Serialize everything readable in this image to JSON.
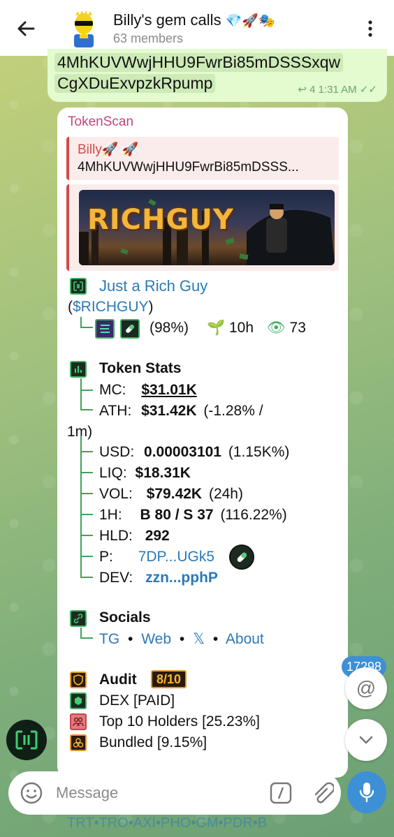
{
  "header": {
    "title": "Billy's gem calls",
    "title_emoji": "💎🚀🎭",
    "members": "63 members"
  },
  "sent_message": {
    "line1": "4MhKUVWwjHHU9FwrBi85mDSSSxqw",
    "line2": "CgXDuExvpzkRpump",
    "replies": "4",
    "time": "1:31 AM"
  },
  "card": {
    "sender": "TokenScan",
    "reply_name": "Billy🚀 🚀",
    "reply_text": "4MhKUVWwjHHU9FwrBi85mDSSS...",
    "banner_text": "RICHGUY",
    "token_name": "Just a Rich Guy",
    "ticker_open": "(",
    "ticker": "$RICHGUY",
    "ticker_close": ")",
    "pct": "(98%)",
    "age": "10h",
    "views": "73",
    "stats_title": "Token Stats",
    "mc_label": "MC:",
    "mc_value": "$31.01K",
    "ath_label": "ATH:",
    "ath_value": "$31.42K",
    "ath_change": "(-1.28% /",
    "ath_period": "1m)",
    "usd_label": "USD:",
    "usd_value": "0.00003101",
    "usd_change": "(1.15K%)",
    "liq_label": "LIQ:",
    "liq_value": "$18.31K",
    "vol_label": "VOL:",
    "vol_value": "$79.42K",
    "vol_period": "(24h)",
    "h1_label": "1H:",
    "h1_value": "B 80 / S 37",
    "h1_change": "(116.22%)",
    "hld_label": "HLD:",
    "hld_value": "292",
    "p_label": "P:",
    "p_value": "7DP...UGk5",
    "dev_label": "DEV:",
    "dev_value": "zzn...pphP",
    "socials_title": "Socials",
    "social_tg": "TG",
    "social_web": "Web",
    "social_x": "𝕏",
    "social_about": "About",
    "bullet": "•",
    "audit_title": "Audit",
    "audit_score": "8/10",
    "audit_dex": "DEX [PAID]",
    "audit_top10": "Top 10 Holders [25.23%]",
    "audit_bundled": "Bundled [9.15%]"
  },
  "mentions_count": "17298",
  "composer": {
    "placeholder": "Message"
  },
  "bottom_strip": "TRT•TRO•AXI•PHO•GM•PDR•B",
  "colors": {
    "accent": "#3d8fd6",
    "sent_bubble": "#e3fbcf",
    "sender_name": "#c2447f",
    "link": "#2a7ab8",
    "tree_green": "#3fa25a"
  }
}
